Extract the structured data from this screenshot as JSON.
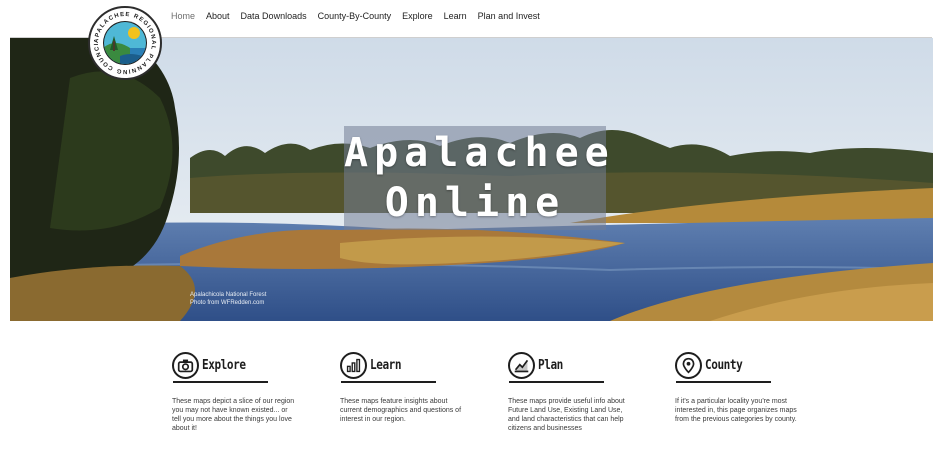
{
  "logo": {
    "ring_text": "APALACHEE REGIONAL PLANNING COUNCIL"
  },
  "nav": {
    "items": [
      {
        "label": "Home",
        "active": true
      },
      {
        "label": "About"
      },
      {
        "label": "Data Downloads"
      },
      {
        "label": "County-By-County"
      },
      {
        "label": "Explore"
      },
      {
        "label": "Learn"
      },
      {
        "label": "Plan and Invest"
      }
    ]
  },
  "hero": {
    "title_line1": "Apalachee",
    "title_line2": "Online",
    "caption_line1": "Apalachicola National Forest",
    "caption_line2": "Photo from WFRedden.com"
  },
  "cards": [
    {
      "label": "Explore",
      "icon": "camera-icon",
      "description": "These maps depict a slice of our region you may not have known existed... or tell you more about the things you love about it!"
    },
    {
      "label": "Learn",
      "icon": "bar-chart-icon",
      "description": "These maps feature insights about current demographics and questions of interest in our region."
    },
    {
      "label": "Plan",
      "icon": "trend-chart-icon",
      "description": "These maps provide useful info about Future Land Use, Existing Land Use, and land characteristics that can help citizens and businesses"
    },
    {
      "label": "County",
      "icon": "location-pin-icon",
      "description": "If it's a particular locality you're most interested in, this page organizes maps from the previous categories by county."
    }
  ],
  "colors": {
    "accent": "#1e1e1e",
    "title_box": "#737d96",
    "nav_active": "#6e6e6e"
  }
}
